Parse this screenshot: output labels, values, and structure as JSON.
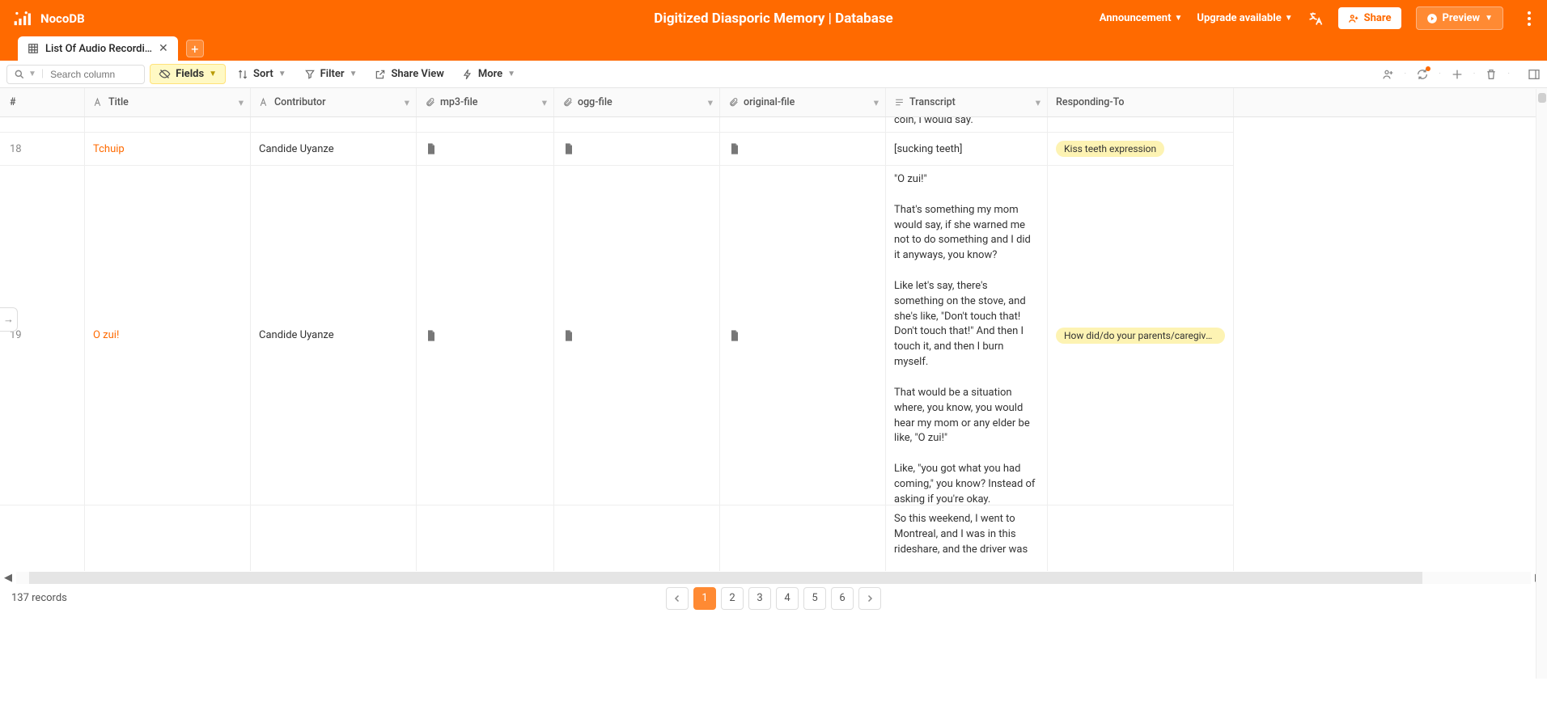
{
  "brand": "NocoDB",
  "database_title": "Digitized Diasporic Memory | Database",
  "top_menu": {
    "announcement": "Announcement",
    "upgrade": "Upgrade available",
    "share": "Share",
    "preview": "Preview"
  },
  "tab": {
    "title": "List Of Audio Recordi…"
  },
  "toolbar": {
    "search_placeholder": "Search column",
    "fields": "Fields",
    "sort": "Sort",
    "filter": "Filter",
    "share_view": "Share View",
    "more": "More"
  },
  "columns": {
    "num": "#",
    "title": "Title",
    "contributor": "Contributor",
    "mp3": "mp3-file",
    "ogg": "ogg-file",
    "original": "original-file",
    "transcript": "Transcript",
    "responding": "Responding-To"
  },
  "rows": {
    "row17_transcript_tail": "coin, I would say.",
    "row18": {
      "num": "18",
      "title": "Tchuip",
      "contributor": "Candide Uyanze",
      "transcript": "[sucking teeth]",
      "responding": "Kiss teeth expression"
    },
    "row19": {
      "num": "19",
      "title": "O zui!",
      "contributor": "Candide Uyanze",
      "transcript": "\"O zui!\"\n\nThat's something my mom would say, if she warned me not to do something and I did it anyways, you know?\n\nLike let's say, there's something on the stove, and she's like, \"Don't touch that! Don't touch that!\" And then I touch it, and then I burn myself.\n\nThat would be a situation where, you know, you would hear my mom or any elder be like, \"O zui!\"\n\nLike, \"you got what you had coming,\" you know? Instead of asking if you're okay.",
      "responding": "How did/do your parents/caregivers/a…"
    },
    "row20": {
      "transcript": "So this weekend, I went to Montreal, and I was in this rideshare, and the driver was"
    }
  },
  "footer": {
    "record_count": "137 records",
    "pages": [
      "1",
      "2",
      "3",
      "4",
      "5",
      "6"
    ]
  }
}
